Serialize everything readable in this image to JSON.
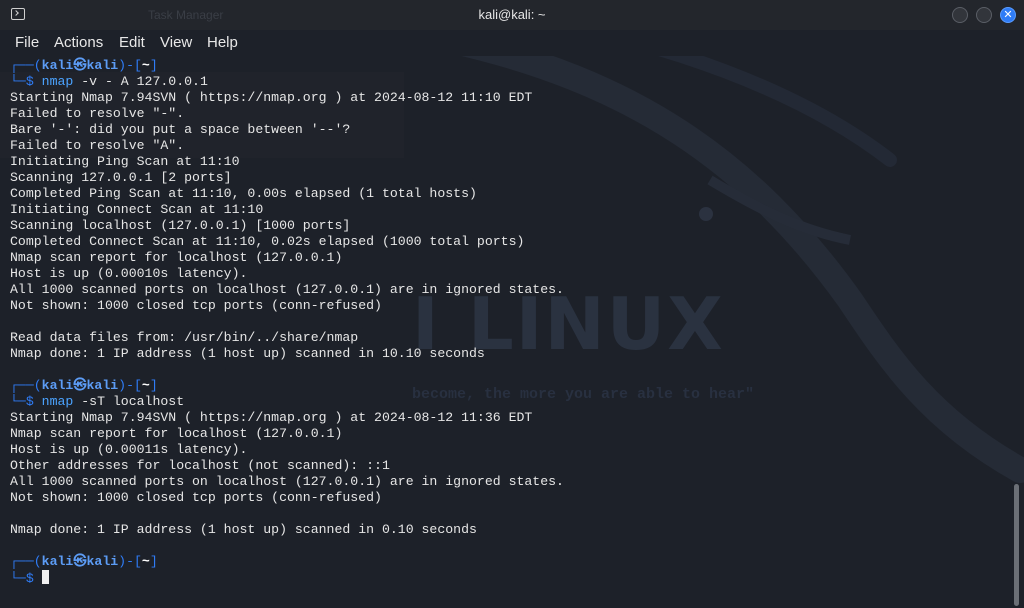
{
  "window": {
    "title": "kali@kali: ~",
    "behind_title": "Task Manager",
    "close_glyph": "✕"
  },
  "menu": [
    "File",
    "Actions",
    "Edit",
    "View",
    "Help"
  ],
  "background": {
    "logo_text": "I LINUX",
    "tagline": "become, the more you are able to hear\""
  },
  "prompt": {
    "top_prefix": "┌──(",
    "user": "kali",
    "at": "㉿",
    "host": "kali",
    "mid": ")-[",
    "dir": "~",
    "end": "]",
    "bottom_prefix": "└─",
    "symbol": "$"
  },
  "session": [
    {
      "cmd_name": "nmap",
      "cmd_args": " -v - A 127.0.0.1",
      "output": [
        "Starting Nmap 7.94SVN ( https://nmap.org ) at 2024-08-12 11:10 EDT",
        "Failed to resolve \"-\".",
        "Bare '-': did you put a space between '--'?",
        "Failed to resolve \"A\".",
        "Initiating Ping Scan at 11:10",
        "Scanning 127.0.0.1 [2 ports]",
        "Completed Ping Scan at 11:10, 0.00s elapsed (1 total hosts)",
        "Initiating Connect Scan at 11:10",
        "Scanning localhost (127.0.0.1) [1000 ports]",
        "Completed Connect Scan at 11:10, 0.02s elapsed (1000 total ports)",
        "Nmap scan report for localhost (127.0.0.1)",
        "Host is up (0.00010s latency).",
        "All 1000 scanned ports on localhost (127.0.0.1) are in ignored states.",
        "Not shown: 1000 closed tcp ports (conn-refused)",
        "",
        "Read data files from: /usr/bin/../share/nmap",
        "Nmap done: 1 IP address (1 host up) scanned in 10.10 seconds",
        ""
      ]
    },
    {
      "cmd_name": "nmap",
      "cmd_args": " -sT localhost",
      "output": [
        "Starting Nmap 7.94SVN ( https://nmap.org ) at 2024-08-12 11:36 EDT",
        "Nmap scan report for localhost (127.0.0.1)",
        "Host is up (0.00011s latency).",
        "Other addresses for localhost (not scanned): ::1",
        "All 1000 scanned ports on localhost (127.0.0.1) are in ignored states.",
        "Not shown: 1000 closed tcp ports (conn-refused)",
        "",
        "Nmap done: 1 IP address (1 host up) scanned in 0.10 seconds",
        ""
      ]
    }
  ],
  "colors": {
    "prompt_frame": "#2f7cf6",
    "prompt_user": "#5c9cf5",
    "command": "#4ba3ff",
    "text": "#e6e6e6",
    "background": "#1d2129"
  },
  "icons": {
    "app": "terminal-icon",
    "minimize": "minimize-icon",
    "maximize": "maximize-icon",
    "close": "close-icon"
  }
}
